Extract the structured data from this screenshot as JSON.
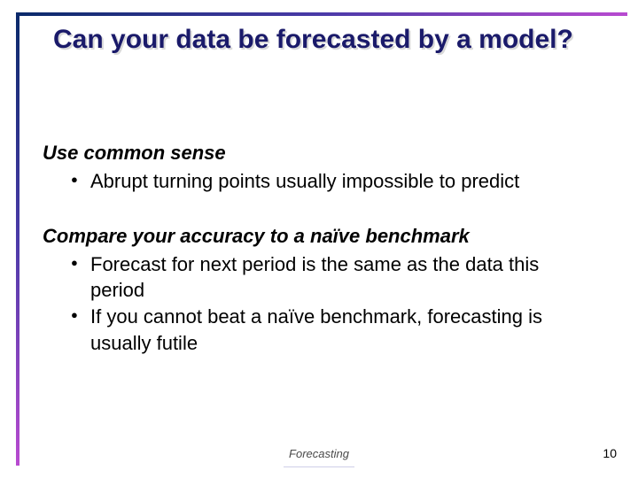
{
  "title": "Can your data be forecasted by a model?",
  "sections": [
    {
      "heading": "Use common sense",
      "bullets": [
        "Abrupt turning points usually impossible to predict"
      ]
    },
    {
      "heading": "Compare your accuracy to a naïve benchmark",
      "bullets": [
        "Forecast for next period is the same as the data this period",
        "If you cannot beat a naïve benchmark, forecasting is usually futile"
      ]
    }
  ],
  "footer": "Forecasting",
  "page_number": "10"
}
